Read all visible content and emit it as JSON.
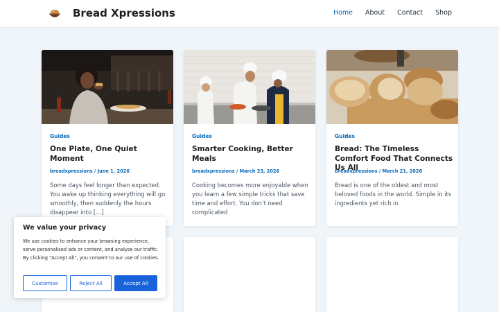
{
  "site": {
    "title": "Bread Xpressions",
    "logo_icon": "bread-bowl-icon"
  },
  "nav": {
    "items": [
      {
        "label": "Home",
        "active": true
      },
      {
        "label": "About",
        "active": false
      },
      {
        "label": "Contact",
        "active": false
      },
      {
        "label": "Shop",
        "active": false
      }
    ]
  },
  "posts": [
    {
      "category": "Guides",
      "title": "One Plate, One Quiet Moment",
      "author": "breadxpressions",
      "separator": " / ",
      "date": "June 1, 2026",
      "excerpt": "Some days feel longer than expected. You wake up thinking everything will go smoothly, then suddenly the hours disappear into […]"
    },
    {
      "category": "Guides",
      "title": "Smarter Cooking, Better Meals",
      "author": "breadxpressions",
      "separator": " / ",
      "date": "March 23, 2026",
      "excerpt": "Cooking becomes more enjoyable when you learn a few simple tricks that save time and effort. You don’t need complicated"
    },
    {
      "category": "Guides",
      "title": "Bread: The Timeless Comfort Food That Connects Us All",
      "author": "breadxpressions",
      "separator": " / ",
      "date": "March 21, 2026",
      "excerpt": "Bread is one of the oldest and most beloved foods in the world. Simple in its ingredients yet rich in"
    }
  ],
  "cookie_banner": {
    "title": "We value your privacy",
    "text": "We use cookies to enhance your browsing experience, serve personalised ads or content, and analyse our traffic. By clicking \"Accept All\", you consent to our use of cookies.",
    "customise_label": "Customise",
    "reject_label": "Reject All",
    "accept_label": "Accept All"
  },
  "colors": {
    "accent": "#0b6ab8",
    "button": "#1863dc",
    "background": "#f0f5fa"
  }
}
